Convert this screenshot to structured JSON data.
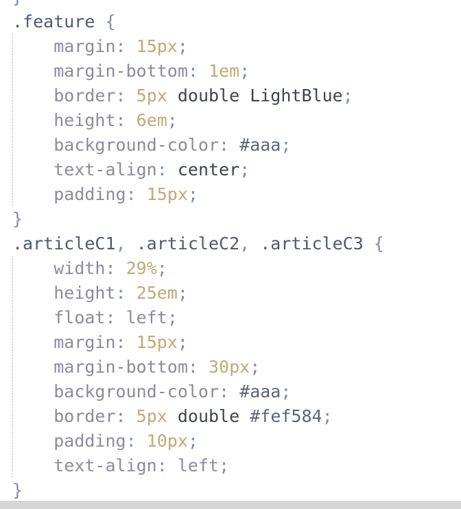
{
  "editor": {
    "lines": [
      {
        "tokens": [
          {
            "t": "}",
            "c": "brace"
          }
        ]
      },
      {
        "tokens": [
          {
            "t": ".feature",
            "c": "sel"
          },
          {
            "t": " ",
            "c": "val"
          },
          {
            "t": "{",
            "c": "brace"
          }
        ]
      },
      {
        "tokens": [
          {
            "t": "    ",
            "c": "val"
          },
          {
            "t": "margin",
            "c": "prop"
          },
          {
            "t": ": ",
            "c": "punct"
          },
          {
            "t": "15px",
            "c": "num"
          },
          {
            "t": ";",
            "c": "punct"
          }
        ]
      },
      {
        "tokens": [
          {
            "t": "    ",
            "c": "val"
          },
          {
            "t": "margin-bottom",
            "c": "prop"
          },
          {
            "t": ": ",
            "c": "punct"
          },
          {
            "t": "1em",
            "c": "num"
          },
          {
            "t": ";",
            "c": "punct"
          }
        ]
      },
      {
        "tokens": [
          {
            "t": "    ",
            "c": "val"
          },
          {
            "t": "border",
            "c": "prop"
          },
          {
            "t": ": ",
            "c": "punct"
          },
          {
            "t": "5px",
            "c": "num"
          },
          {
            "t": " double LightBlue",
            "c": "val"
          },
          {
            "t": ";",
            "c": "punct"
          }
        ]
      },
      {
        "tokens": [
          {
            "t": "    ",
            "c": "val"
          },
          {
            "t": "height",
            "c": "prop"
          },
          {
            "t": ": ",
            "c": "punct"
          },
          {
            "t": "6em",
            "c": "num"
          },
          {
            "t": ";",
            "c": "punct"
          }
        ]
      },
      {
        "tokens": [
          {
            "t": "    ",
            "c": "val"
          },
          {
            "t": "background-color",
            "c": "prop"
          },
          {
            "t": ": ",
            "c": "punct"
          },
          {
            "t": "#aaa",
            "c": "hex"
          },
          {
            "t": ";",
            "c": "punct"
          }
        ]
      },
      {
        "tokens": [
          {
            "t": "    ",
            "c": "val"
          },
          {
            "t": "text-align",
            "c": "prop"
          },
          {
            "t": ": ",
            "c": "punct"
          },
          {
            "t": "center",
            "c": "val"
          },
          {
            "t": ";",
            "c": "punct"
          }
        ]
      },
      {
        "tokens": [
          {
            "t": "    ",
            "c": "val"
          },
          {
            "t": "padding",
            "c": "prop"
          },
          {
            "t": ": ",
            "c": "punct"
          },
          {
            "t": "15px",
            "c": "num"
          },
          {
            "t": ";",
            "c": "punct"
          }
        ]
      },
      {
        "tokens": [
          {
            "t": "}",
            "c": "brace"
          }
        ]
      },
      {
        "tokens": [
          {
            "t": ".articleC1",
            "c": "sel"
          },
          {
            "t": ", ",
            "c": "punct"
          },
          {
            "t": ".articleC2",
            "c": "sel"
          },
          {
            "t": ", ",
            "c": "punct"
          },
          {
            "t": ".articleC3",
            "c": "sel"
          },
          {
            "t": " ",
            "c": "val"
          },
          {
            "t": "{",
            "c": "brace"
          }
        ]
      },
      {
        "tokens": [
          {
            "t": "    ",
            "c": "val"
          },
          {
            "t": "width",
            "c": "prop"
          },
          {
            "t": ": ",
            "c": "punct"
          },
          {
            "t": "29%",
            "c": "num"
          },
          {
            "t": ";",
            "c": "punct"
          }
        ]
      },
      {
        "tokens": [
          {
            "t": "    ",
            "c": "val"
          },
          {
            "t": "height",
            "c": "prop"
          },
          {
            "t": ": ",
            "c": "punct"
          },
          {
            "t": "25em",
            "c": "num"
          },
          {
            "t": ";",
            "c": "punct"
          }
        ]
      },
      {
        "tokens": [
          {
            "t": "    ",
            "c": "val"
          },
          {
            "t": "float",
            "c": "prop"
          },
          {
            "t": ": ",
            "c": "punct"
          },
          {
            "t": "left",
            "c": "prop"
          },
          {
            "t": ";",
            "c": "punct"
          }
        ]
      },
      {
        "tokens": [
          {
            "t": "    ",
            "c": "val"
          },
          {
            "t": "margin",
            "c": "prop"
          },
          {
            "t": ": ",
            "c": "punct"
          },
          {
            "t": "15px",
            "c": "num"
          },
          {
            "t": ";",
            "c": "punct"
          }
        ]
      },
      {
        "tokens": [
          {
            "t": "    ",
            "c": "val"
          },
          {
            "t": "margin-bottom",
            "c": "prop"
          },
          {
            "t": ": ",
            "c": "punct"
          },
          {
            "t": "30px",
            "c": "num"
          },
          {
            "t": ";",
            "c": "punct"
          }
        ]
      },
      {
        "tokens": [
          {
            "t": "    ",
            "c": "val"
          },
          {
            "t": "background-color",
            "c": "prop"
          },
          {
            "t": ": ",
            "c": "punct"
          },
          {
            "t": "#aaa",
            "c": "hex"
          },
          {
            "t": ";",
            "c": "punct"
          }
        ]
      },
      {
        "tokens": [
          {
            "t": "    ",
            "c": "val"
          },
          {
            "t": "border",
            "c": "prop"
          },
          {
            "t": ": ",
            "c": "punct"
          },
          {
            "t": "5px",
            "c": "num"
          },
          {
            "t": " double ",
            "c": "val"
          },
          {
            "t": "#fef584",
            "c": "hex"
          },
          {
            "t": ";",
            "c": "punct"
          }
        ]
      },
      {
        "tokens": [
          {
            "t": "    ",
            "c": "val"
          },
          {
            "t": "padding",
            "c": "prop"
          },
          {
            "t": ": ",
            "c": "punct"
          },
          {
            "t": "10px",
            "c": "num"
          },
          {
            "t": ";",
            "c": "punct"
          }
        ]
      },
      {
        "tokens": [
          {
            "t": "    ",
            "c": "val"
          },
          {
            "t": "text-align",
            "c": "prop"
          },
          {
            "t": ": ",
            "c": "punct"
          },
          {
            "t": "left",
            "c": "prop"
          },
          {
            "t": ";",
            "c": "punct"
          }
        ]
      },
      {
        "tokens": [
          {
            "t": "}",
            "c": "brace"
          }
        ]
      }
    ]
  },
  "colors": {
    "background": "#ffffff",
    "selector": "#4d5a70",
    "brace": "#7e8ea8",
    "property": "#8c8aa0",
    "number": "#c4a874",
    "value": "#3e4350",
    "hex": "#5c6478",
    "scrollbar": "#d6d6d6"
  }
}
